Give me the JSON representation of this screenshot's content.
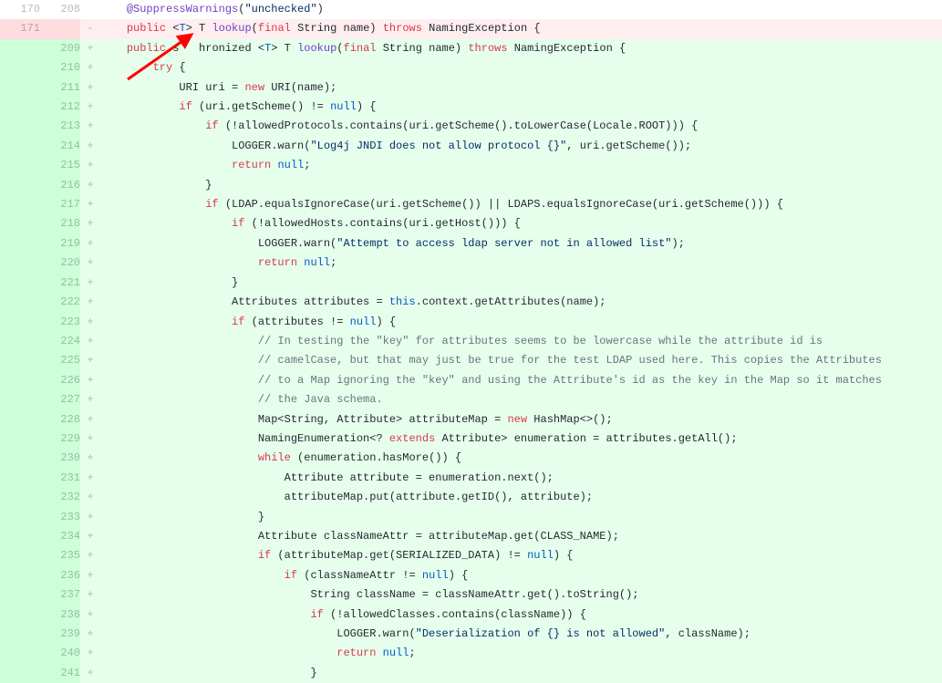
{
  "rows": [
    {
      "old": "170",
      "new": "208",
      "type": "context",
      "mk": " ",
      "tokens": [
        {
          "t": "    ",
          "c": ""
        },
        {
          "t": "@SuppressWarnings",
          "c": "fn"
        },
        {
          "t": "(",
          "c": ""
        },
        {
          "t": "\"unchecked\"",
          "c": "s"
        },
        {
          "t": ")",
          "c": ""
        }
      ]
    },
    {
      "old": "171",
      "new": "",
      "type": "del",
      "mk": "-",
      "tokens": [
        {
          "t": "    ",
          "c": ""
        },
        {
          "t": "public",
          "c": "k"
        },
        {
          "t": " <",
          "c": ""
        },
        {
          "t": "T",
          "c": "cn"
        },
        {
          "t": "> T ",
          "c": ""
        },
        {
          "t": "lookup",
          "c": "fn"
        },
        {
          "t": "(",
          "c": ""
        },
        {
          "t": "final",
          "c": "k"
        },
        {
          "t": " String name) ",
          "c": ""
        },
        {
          "t": "throws",
          "c": "k"
        },
        {
          "t": " NamingException {",
          "c": ""
        }
      ]
    },
    {
      "old": "",
      "new": "209",
      "type": "add",
      "mk": "+",
      "tokens": [
        {
          "t": "    ",
          "c": ""
        },
        {
          "t": "public",
          "c": "k"
        },
        {
          "t": " s   hronized <",
          "c": ""
        },
        {
          "t": "T",
          "c": "cn"
        },
        {
          "t": "> T ",
          "c": ""
        },
        {
          "t": "lookup",
          "c": "fn"
        },
        {
          "t": "(",
          "c": ""
        },
        {
          "t": "final",
          "c": "k"
        },
        {
          "t": " String name) ",
          "c": ""
        },
        {
          "t": "throws",
          "c": "k"
        },
        {
          "t": " NamingException {",
          "c": ""
        }
      ]
    },
    {
      "old": "",
      "new": "210",
      "type": "add",
      "mk": "+",
      "tokens": [
        {
          "t": "        ",
          "c": ""
        },
        {
          "t": "try",
          "c": "k"
        },
        {
          "t": " {",
          "c": ""
        }
      ]
    },
    {
      "old": "",
      "new": "211",
      "type": "add",
      "mk": "+",
      "tokens": [
        {
          "t": "            URI uri = ",
          "c": ""
        },
        {
          "t": "new",
          "c": "k"
        },
        {
          "t": " URI(name);",
          "c": ""
        }
      ]
    },
    {
      "old": "",
      "new": "212",
      "type": "add",
      "mk": "+",
      "tokens": [
        {
          "t": "            ",
          "c": ""
        },
        {
          "t": "if",
          "c": "k"
        },
        {
          "t": " (uri.getScheme() != ",
          "c": ""
        },
        {
          "t": "null",
          "c": "cn"
        },
        {
          "t": ") {",
          "c": ""
        }
      ]
    },
    {
      "old": "",
      "new": "213",
      "type": "add",
      "mk": "+",
      "tokens": [
        {
          "t": "                ",
          "c": ""
        },
        {
          "t": "if",
          "c": "k"
        },
        {
          "t": " (!allowedProtocols.contains(uri.getScheme().toLowerCase(Locale.ROOT))) {",
          "c": ""
        }
      ]
    },
    {
      "old": "",
      "new": "214",
      "type": "add",
      "mk": "+",
      "tokens": [
        {
          "t": "                    LOGGER.warn(",
          "c": ""
        },
        {
          "t": "\"Log4j JNDI does not allow protocol {}\"",
          "c": "s"
        },
        {
          "t": ", uri.getScheme());",
          "c": ""
        }
      ]
    },
    {
      "old": "",
      "new": "215",
      "type": "add",
      "mk": "+",
      "tokens": [
        {
          "t": "                    ",
          "c": ""
        },
        {
          "t": "return",
          "c": "k"
        },
        {
          "t": " ",
          "c": ""
        },
        {
          "t": "null",
          "c": "cn"
        },
        {
          "t": ";",
          "c": ""
        }
      ]
    },
    {
      "old": "",
      "new": "216",
      "type": "add",
      "mk": "+",
      "tokens": [
        {
          "t": "                }",
          "c": ""
        }
      ]
    },
    {
      "old": "",
      "new": "217",
      "type": "add",
      "mk": "+",
      "tokens": [
        {
          "t": "                ",
          "c": ""
        },
        {
          "t": "if",
          "c": "k"
        },
        {
          "t": " (LDAP.equalsIgnoreCase(uri.getScheme()) || LDAPS.equalsIgnoreCase(uri.getScheme())) {",
          "c": ""
        }
      ]
    },
    {
      "old": "",
      "new": "218",
      "type": "add",
      "mk": "+",
      "tokens": [
        {
          "t": "                    ",
          "c": ""
        },
        {
          "t": "if",
          "c": "k"
        },
        {
          "t": " (!allowedHosts.contains(uri.getHost())) {",
          "c": ""
        }
      ]
    },
    {
      "old": "",
      "new": "219",
      "type": "add",
      "mk": "+",
      "tokens": [
        {
          "t": "                        LOGGER.warn(",
          "c": ""
        },
        {
          "t": "\"Attempt to access ldap server not in allowed list\"",
          "c": "s"
        },
        {
          "t": ");",
          "c": ""
        }
      ]
    },
    {
      "old": "",
      "new": "220",
      "type": "add",
      "mk": "+",
      "tokens": [
        {
          "t": "                        ",
          "c": ""
        },
        {
          "t": "return",
          "c": "k"
        },
        {
          "t": " ",
          "c": ""
        },
        {
          "t": "null",
          "c": "cn"
        },
        {
          "t": ";",
          "c": ""
        }
      ]
    },
    {
      "old": "",
      "new": "221",
      "type": "add",
      "mk": "+",
      "tokens": [
        {
          "t": "                    }",
          "c": ""
        }
      ]
    },
    {
      "old": "",
      "new": "222",
      "type": "add",
      "mk": "+",
      "tokens": [
        {
          "t": "                    Attributes attributes = ",
          "c": ""
        },
        {
          "t": "this",
          "c": "cn"
        },
        {
          "t": ".context.getAttributes(name);",
          "c": ""
        }
      ]
    },
    {
      "old": "",
      "new": "223",
      "type": "add",
      "mk": "+",
      "tokens": [
        {
          "t": "                    ",
          "c": ""
        },
        {
          "t": "if",
          "c": "k"
        },
        {
          "t": " (attributes != ",
          "c": ""
        },
        {
          "t": "null",
          "c": "cn"
        },
        {
          "t": ") {",
          "c": ""
        }
      ]
    },
    {
      "old": "",
      "new": "224",
      "type": "add",
      "mk": "+",
      "tokens": [
        {
          "t": "                        ",
          "c": ""
        },
        {
          "t": "// In testing the \"key\" for attributes seems to be lowercase while the attribute id is",
          "c": "c"
        }
      ]
    },
    {
      "old": "",
      "new": "225",
      "type": "add",
      "mk": "+",
      "tokens": [
        {
          "t": "                        ",
          "c": ""
        },
        {
          "t": "// camelCase, but that may just be true for the test LDAP used here. This copies the Attributes",
          "c": "c"
        }
      ]
    },
    {
      "old": "",
      "new": "226",
      "type": "add",
      "mk": "+",
      "tokens": [
        {
          "t": "                        ",
          "c": ""
        },
        {
          "t": "// to a Map ignoring the \"key\" and using the Attribute's id as the key in the Map so it matches",
          "c": "c"
        }
      ]
    },
    {
      "old": "",
      "new": "227",
      "type": "add",
      "mk": "+",
      "tokens": [
        {
          "t": "                        ",
          "c": ""
        },
        {
          "t": "// the Java schema.",
          "c": "c"
        }
      ]
    },
    {
      "old": "",
      "new": "228",
      "type": "add",
      "mk": "+",
      "tokens": [
        {
          "t": "                        Map<String, Attribute> attributeMap = ",
          "c": ""
        },
        {
          "t": "new",
          "c": "k"
        },
        {
          "t": " HashMap<>();",
          "c": ""
        }
      ]
    },
    {
      "old": "",
      "new": "229",
      "type": "add",
      "mk": "+",
      "tokens": [
        {
          "t": "                        NamingEnumeration<? ",
          "c": ""
        },
        {
          "t": "extends",
          "c": "k"
        },
        {
          "t": " Attribute> enumeration = attributes.getAll();",
          "c": ""
        }
      ]
    },
    {
      "old": "",
      "new": "230",
      "type": "add",
      "mk": "+",
      "tokens": [
        {
          "t": "                        ",
          "c": ""
        },
        {
          "t": "while",
          "c": "k"
        },
        {
          "t": " (enumeration.hasMore()) {",
          "c": ""
        }
      ]
    },
    {
      "old": "",
      "new": "231",
      "type": "add",
      "mk": "+",
      "tokens": [
        {
          "t": "                            Attribute attribute = enumeration.next();",
          "c": ""
        }
      ]
    },
    {
      "old": "",
      "new": "232",
      "type": "add",
      "mk": "+",
      "tokens": [
        {
          "t": "                            attributeMap.put(attribute.getID(), attribute);",
          "c": ""
        }
      ]
    },
    {
      "old": "",
      "new": "233",
      "type": "add",
      "mk": "+",
      "tokens": [
        {
          "t": "                        }",
          "c": ""
        }
      ]
    },
    {
      "old": "",
      "new": "234",
      "type": "add",
      "mk": "+",
      "tokens": [
        {
          "t": "                        Attribute classNameAttr = attributeMap.get(CLASS_NAME);",
          "c": ""
        }
      ]
    },
    {
      "old": "",
      "new": "235",
      "type": "add",
      "mk": "+",
      "tokens": [
        {
          "t": "                        ",
          "c": ""
        },
        {
          "t": "if",
          "c": "k"
        },
        {
          "t": " (attributeMap.get(SERIALIZED_DATA) != ",
          "c": ""
        },
        {
          "t": "null",
          "c": "cn"
        },
        {
          "t": ") {",
          "c": ""
        }
      ]
    },
    {
      "old": "",
      "new": "236",
      "type": "add",
      "mk": "+",
      "tokens": [
        {
          "t": "                            ",
          "c": ""
        },
        {
          "t": "if",
          "c": "k"
        },
        {
          "t": " (classNameAttr != ",
          "c": ""
        },
        {
          "t": "null",
          "c": "cn"
        },
        {
          "t": ") {",
          "c": ""
        }
      ]
    },
    {
      "old": "",
      "new": "237",
      "type": "add",
      "mk": "+",
      "tokens": [
        {
          "t": "                                String className = classNameAttr.get().toString();",
          "c": ""
        }
      ]
    },
    {
      "old": "",
      "new": "238",
      "type": "add",
      "mk": "+",
      "tokens": [
        {
          "t": "                                ",
          "c": ""
        },
        {
          "t": "if",
          "c": "k"
        },
        {
          "t": " (!allowedClasses.contains(className)) {",
          "c": ""
        }
      ]
    },
    {
      "old": "",
      "new": "239",
      "type": "add",
      "mk": "+",
      "tokens": [
        {
          "t": "                                    LOGGER.warn(",
          "c": ""
        },
        {
          "t": "\"Deserialization of {} is not allowed\"",
          "c": "s"
        },
        {
          "t": ", className);",
          "c": ""
        }
      ]
    },
    {
      "old": "",
      "new": "240",
      "type": "add",
      "mk": "+",
      "tokens": [
        {
          "t": "                                    ",
          "c": ""
        },
        {
          "t": "return",
          "c": "k"
        },
        {
          "t": " ",
          "c": ""
        },
        {
          "t": "null",
          "c": "cn"
        },
        {
          "t": ";",
          "c": ""
        }
      ]
    },
    {
      "old": "",
      "new": "241",
      "type": "add",
      "mk": "+",
      "tokens": [
        {
          "t": "                                }",
          "c": ""
        }
      ]
    }
  ],
  "annotation": {
    "kind": "arrow",
    "color": "#ff0000"
  }
}
